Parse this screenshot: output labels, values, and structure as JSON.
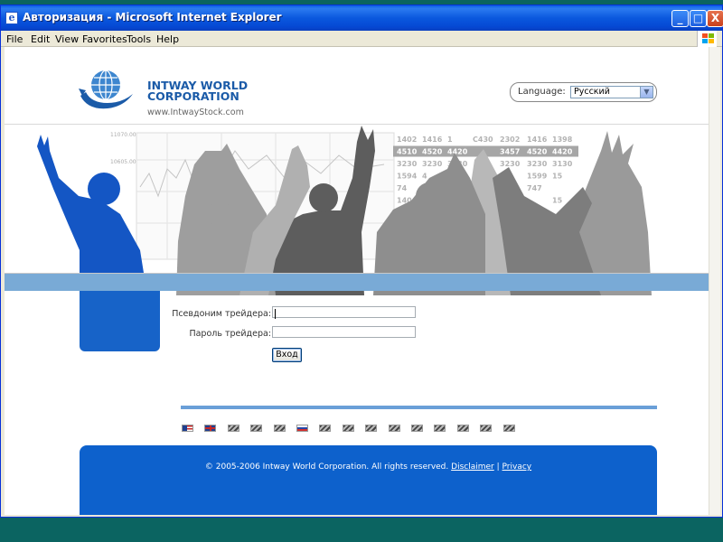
{
  "window": {
    "title": "Авторизация - Microsoft Internet Explorer",
    "controls": {
      "minimize": "_",
      "maximize": "□",
      "close": "X"
    }
  },
  "menu": [
    "File",
    "Edit",
    "View",
    "Favorites",
    "Tools",
    "Help"
  ],
  "page": {
    "logo": {
      "line1": "INTWAY WORLD",
      "line2": "CORPORATION",
      "url": "www.IntwayStock.com"
    },
    "language": {
      "label": "Language:",
      "selected": "Русский"
    },
    "login": {
      "username_label": "Псевдоним трейдера:",
      "password_label": "Пароль трейдера:",
      "submit_label": "Вход"
    },
    "flags": [
      "us-flag-icon",
      "uk-flag-icon",
      "flag-icon",
      "flag-icon",
      "flag-icon",
      "russia-flag-icon",
      "flag-icon",
      "flag-icon",
      "flag-icon",
      "flag-icon",
      "flag-icon",
      "flag-icon",
      "flag-icon",
      "flag-icon",
      "flag-icon"
    ],
    "footer": {
      "copyright": "© 2005-2006 Intway World Corporation. All rights reserved.",
      "disclaimer": "Disclaimer",
      "divider": "|",
      "privacy": "Privacy"
    },
    "banner": {
      "chart_values": [
        "11070.00",
        "10605.00"
      ],
      "ticker": [
        [
          "1402",
          "1416",
          "1",
          "C430",
          "2302",
          "1416",
          "1398"
        ],
        [
          "4510",
          "4520",
          "4420",
          "",
          "3457",
          "4520",
          "4420"
        ],
        [
          "3230",
          "3230",
          "3130",
          "",
          "3230",
          "3230",
          "3130"
        ],
        [
          "1594",
          "4",
          "1560",
          "",
          "80",
          "1599",
          "15"
        ],
        [
          "74",
          "",
          "711",
          "",
          "",
          "747",
          ""
        ],
        [
          "140",
          "1",
          "1388",
          "",
          "",
          "",
          "15"
        ],
        [
          "4510",
          "",
          "4",
          "",
          "",
          "",
          ""
        ]
      ]
    }
  },
  "colors": {
    "brand_blue": "#1763c8",
    "stripe_blue": "#79aad6",
    "titlebar_blue": "#0a58de"
  }
}
